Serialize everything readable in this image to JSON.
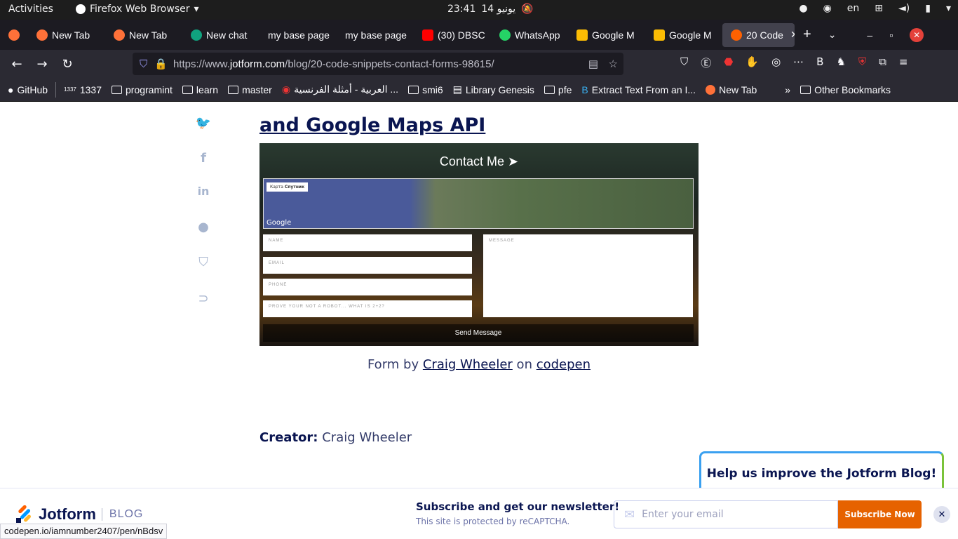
{
  "system": {
    "activities": "Activities",
    "app_name": "Firefox Web Browser",
    "clock": "23:41",
    "date": "14 يونيو",
    "lang": "en"
  },
  "tabs": [
    {
      "label": "New Tab",
      "color": "#ff7139"
    },
    {
      "label": "New Tab",
      "color": "#ff7139"
    },
    {
      "label": "New chat",
      "color": "#10a37f"
    },
    {
      "label": "my base page",
      "color": ""
    },
    {
      "label": "my base page",
      "color": ""
    },
    {
      "label": "(30) DBSC",
      "color": "#ff0000"
    },
    {
      "label": "WhatsApp",
      "color": "#25d366"
    },
    {
      "label": "Google M",
      "color": "#fbbc04"
    },
    {
      "label": "Google M",
      "color": "#fbbc04"
    },
    {
      "label": "20 Code",
      "color": "#ff6100"
    }
  ],
  "nav": {
    "url_prefix": "https://www.",
    "url_host": "jotform.com",
    "url_path": "/blog/20-code-snippets-contact-forms-98615/"
  },
  "bookmarks": [
    {
      "label": "GitHub",
      "icon": "github-icon"
    },
    {
      "label": "1337",
      "icon": "1337-icon"
    },
    {
      "label": "programint",
      "icon": "folder-icon"
    },
    {
      "label": "learn",
      "icon": "folder-icon"
    },
    {
      "label": "master",
      "icon": "folder-icon"
    },
    {
      "label": "العربية - أمثلة الفرنسية ...",
      "icon": "globe-icon"
    },
    {
      "label": "smi6",
      "icon": "folder-icon"
    },
    {
      "label": "Library Genesis",
      "icon": "book-icon"
    },
    {
      "label": "pfe",
      "icon": "folder-icon"
    },
    {
      "label": "Extract Text From an I...",
      "icon": "b-icon"
    },
    {
      "label": "New Tab",
      "icon": "firefox-icon"
    }
  ],
  "other_bookmarks": "Other Bookmarks",
  "article": {
    "heading": "and Google Maps API",
    "demo": {
      "title": "Contact Me",
      "fields": [
        "NAME",
        "EMAIL",
        "PHONE",
        "PROVE YOUR NOT A ROBOT... WHAT IS 2+2?"
      ],
      "message": "MESSAGE",
      "send": "Send Message",
      "map_btn1": "Карта",
      "map_btn2": "Спутник",
      "google": "Google"
    },
    "caption_prefix": "Form by ",
    "caption_author": "Craig Wheeler",
    "caption_mid": " on ",
    "caption_site": "codepen",
    "creator_label": "Creator:",
    "creator_name": " Craig Wheeler"
  },
  "feedback": "Help us improve the Jotform Blog!",
  "newsletter": {
    "brand": "Jotform",
    "blog": "BLOG",
    "title": "Subscribe and get our newsletter!",
    "sub": "This site is protected by reCAPTCHA.",
    "email_placeholder": "Enter your email",
    "button": "Subscribe Now",
    "close": "✕"
  },
  "status_url": "codepen.io/iamnumber2407/pen/nBdsv"
}
